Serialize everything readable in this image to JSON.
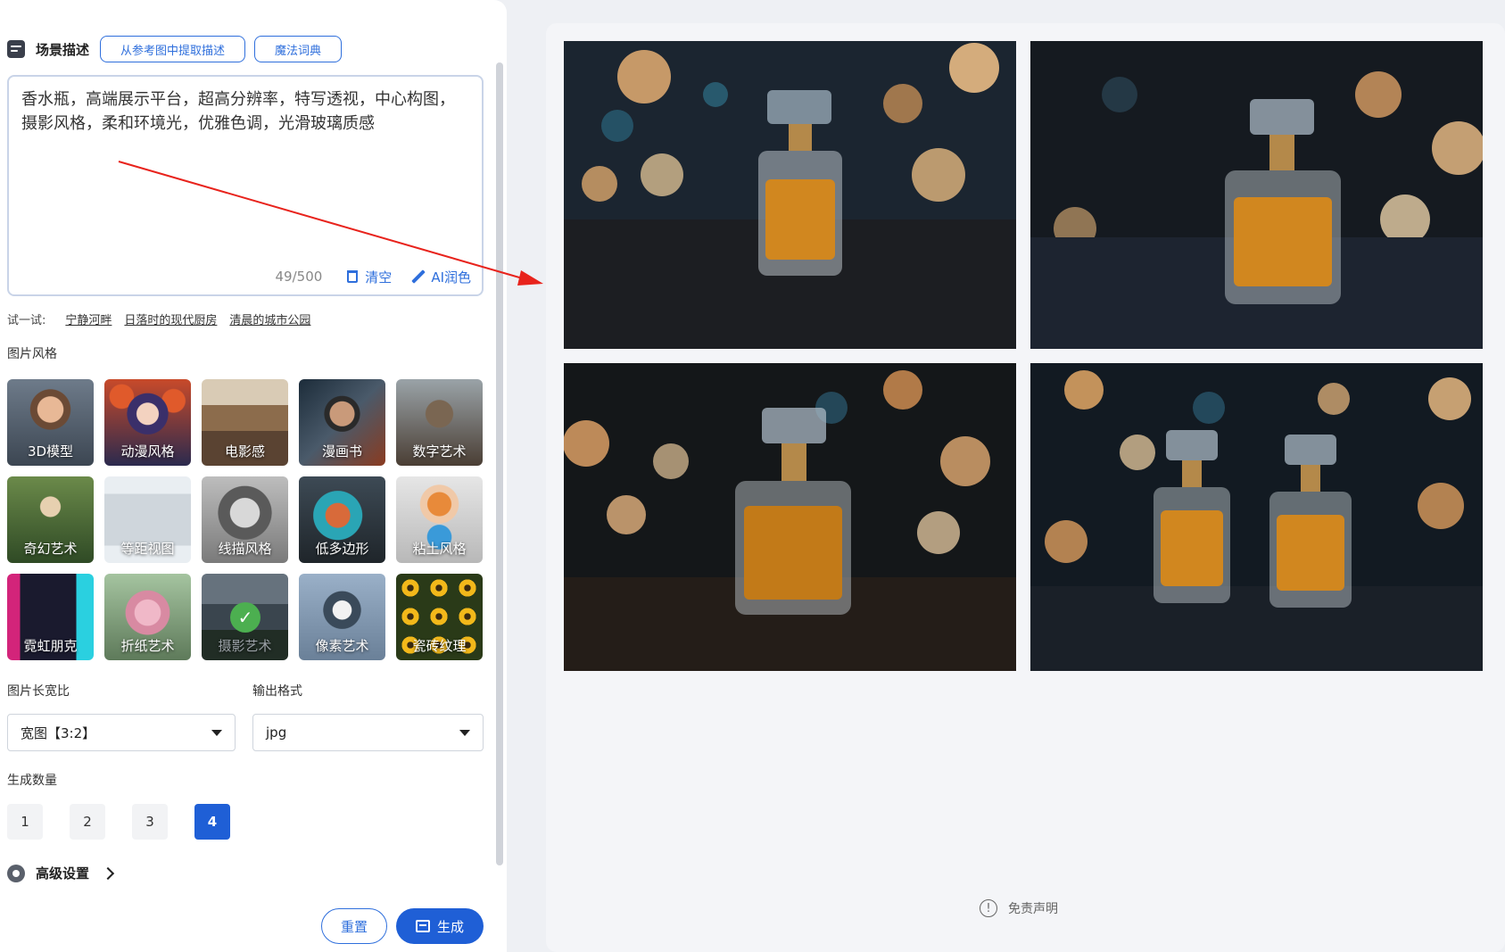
{
  "left_panel": {
    "scene": {
      "title": "场景描述",
      "extract_button": "从参考图中提取描述",
      "dictionary_button": "魔法词典"
    },
    "prompt": {
      "value": "香水瓶，高端展示平台，超高分辨率，特写透视，中心构图，摄影风格，柔和环境光，优雅色调，光滑玻璃质感",
      "counter": "49/500",
      "clear_label": "清空",
      "ai_polish_label": "AI润色"
    },
    "try": {
      "label": "试一试:",
      "examples": [
        "宁静河畔",
        "日落时的现代厨房",
        "清晨的城市公园"
      ]
    },
    "style_section": {
      "label": "图片风格",
      "items": [
        {
          "label": "3D模型",
          "icon": "3d-child-portrait"
        },
        {
          "label": "动漫风格",
          "icon": "anime-girl"
        },
        {
          "label": "电影感",
          "icon": "living-room"
        },
        {
          "label": "漫画书",
          "icon": "comic-man"
        },
        {
          "label": "数字艺术",
          "icon": "warrior"
        },
        {
          "label": "奇幻艺术",
          "icon": "forest-fairy"
        },
        {
          "label": "等距视图",
          "icon": "microwave"
        },
        {
          "label": "线描风格",
          "icon": "sketch-woman"
        },
        {
          "label": "低多边形",
          "icon": "lowpoly-sphere"
        },
        {
          "label": "粘土风格",
          "icon": "clay-boy"
        },
        {
          "label": "霓虹朋克",
          "icon": "neon-punk"
        },
        {
          "label": "折纸艺术",
          "icon": "paper-rose"
        },
        {
          "label": "摄影艺术",
          "icon": "mountains",
          "selected": true
        },
        {
          "label": "像素艺术",
          "icon": "husky"
        },
        {
          "label": "瓷砖纹理",
          "icon": "sunflowers"
        }
      ]
    },
    "aspect": {
      "label": "图片长宽比",
      "value": "宽图【3:2】"
    },
    "format": {
      "label": "输出格式",
      "value": "jpg"
    },
    "count": {
      "label": "生成数量",
      "options": [
        "1",
        "2",
        "3",
        "4"
      ],
      "selected": "4"
    },
    "advanced": {
      "label": "高级设置"
    },
    "actions": {
      "reset": "重置",
      "generate": "生成"
    }
  },
  "right_panel": {
    "images": [
      {
        "alt": "perfume bottle on dark table with warm bokeh"
      },
      {
        "alt": "perfume bottle on glossy surface with bokeh"
      },
      {
        "alt": "perfume bottle with warm bokeh background"
      },
      {
        "alt": "two perfume bottles with bokeh lights"
      }
    ],
    "disclaimer": "免责声明"
  },
  "colors": {
    "accent": "#1f5fd6",
    "accent_light": "#2f6fdc",
    "annotation_arrow": "#e8231c"
  }
}
